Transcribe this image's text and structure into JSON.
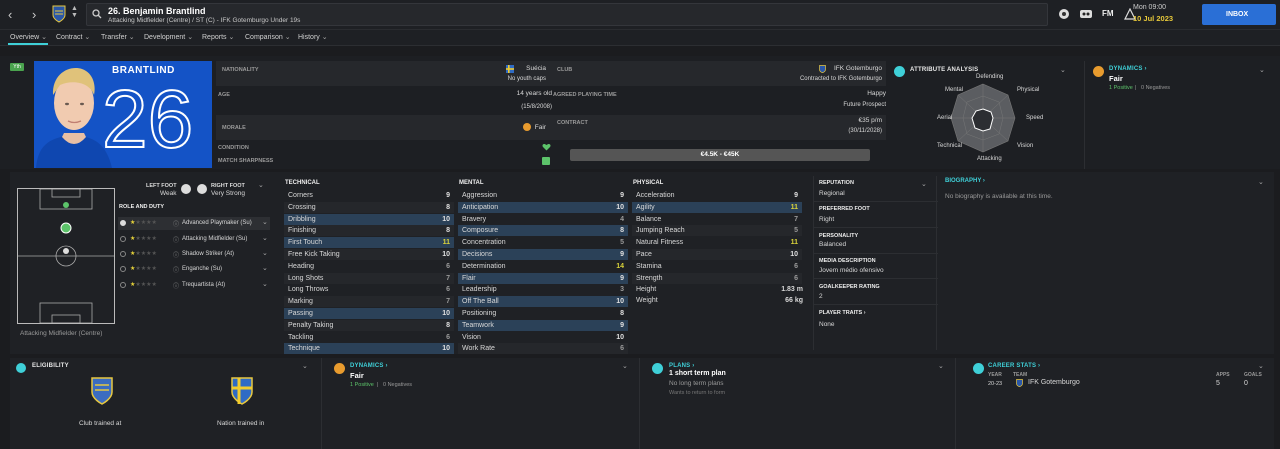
{
  "nav": {
    "back": "‹",
    "forward": "›"
  },
  "header": {
    "title": "26. Benjamin Brantlind",
    "subtitle": "Attacking Midfielder (Centre) / ST (C) - IFK Gotemburgo Under 19s",
    "date_day": "Mon 09:00",
    "date": "10 Jul 2023",
    "inbox": "INBOX",
    "fm": "FM"
  },
  "tabs": [
    {
      "label": "Overview"
    },
    {
      "label": "Contract"
    },
    {
      "label": "Transfer"
    },
    {
      "label": "Development"
    },
    {
      "label": "Reports"
    },
    {
      "label": "Comparison"
    },
    {
      "label": "History"
    }
  ],
  "profile": {
    "badge": "Yth",
    "shirt_name": "BRANTLIND",
    "shirt_number": "26"
  },
  "info": {
    "nationality_label": "NATIONALITY",
    "nationality": "Suécia",
    "youth_caps": "No youth caps",
    "age_label": "AGE",
    "age": "14 years old",
    "dob": "(15/8/2008)",
    "morale_label": "MORALE",
    "morale": "Fair",
    "condition_label": "CONDITION",
    "sharpness_label": "MATCH SHARPNESS",
    "club_label": "CLUB",
    "club": "IFK Gotemburgo",
    "contracted": "Contracted to IFK Gotemburgo",
    "playing_time_label": "AGREED PLAYING TIME",
    "playing_time": "Happy",
    "playing_time_role": "Future Prospect",
    "contract_label": "CONTRACT",
    "wage": "€35 p/m",
    "contract_end": "(30/11/2028)",
    "value": "€4.5K - €45K"
  },
  "attribute_analysis": {
    "title": "ATTRIBUTE ANALYSIS",
    "labels": [
      "Defending",
      "Physical",
      "Speed",
      "Vision",
      "Attacking",
      "Technical",
      "Aerial",
      "Mental"
    ]
  },
  "dynamics_top": {
    "title": "DYNAMICS",
    "value": "Fair",
    "positives": "1 Positive",
    "negatives": "0 Negatives"
  },
  "feet": {
    "left_label": "LEFT FOOT",
    "left": "Weak",
    "right_label": "RIGHT FOOT",
    "right": "Very Strong"
  },
  "role_duty": {
    "title": "ROLE AND DUTY",
    "roles": [
      "Advanced Playmaker (Su)",
      "Attacking Midfielder (Su)",
      "Shadow Striker (At)",
      "Enganche (Su)",
      "Trequartista (At)"
    ]
  },
  "position_caption": "Attacking Midfielder (Centre)",
  "technical": {
    "title": "TECHNICAL",
    "items": [
      [
        "Corners",
        "9"
      ],
      [
        "Crossing",
        "8"
      ],
      [
        "Dribbling",
        "10"
      ],
      [
        "Finishing",
        "8"
      ],
      [
        "First Touch",
        "11"
      ],
      [
        "Free Kick Taking",
        "10"
      ],
      [
        "Heading",
        "6"
      ],
      [
        "Long Shots",
        "7"
      ],
      [
        "Long Throws",
        "6"
      ],
      [
        "Marking",
        "7"
      ],
      [
        "Passing",
        "10"
      ],
      [
        "Penalty Taking",
        "8"
      ],
      [
        "Tackling",
        "6"
      ],
      [
        "Technique",
        "10"
      ]
    ]
  },
  "mental": {
    "title": "MENTAL",
    "items": [
      [
        "Aggression",
        "9"
      ],
      [
        "Anticipation",
        "10"
      ],
      [
        "Bravery",
        "4"
      ],
      [
        "Composure",
        "8"
      ],
      [
        "Concentration",
        "5"
      ],
      [
        "Decisions",
        "9"
      ],
      [
        "Determination",
        "14"
      ],
      [
        "Flair",
        "9"
      ],
      [
        "Leadership",
        "3"
      ],
      [
        "Off The Ball",
        "10"
      ],
      [
        "Positioning",
        "8"
      ],
      [
        "Teamwork",
        "9"
      ],
      [
        "Vision",
        "10"
      ],
      [
        "Work Rate",
        "6"
      ]
    ]
  },
  "physical": {
    "title": "PHYSICAL",
    "items": [
      [
        "Acceleration",
        "9"
      ],
      [
        "Agility",
        "11"
      ],
      [
        "Balance",
        "7"
      ],
      [
        "Jumping Reach",
        "5"
      ],
      [
        "Natural Fitness",
        "11"
      ],
      [
        "Pace",
        "10"
      ],
      [
        "Stamina",
        "6"
      ],
      [
        "Strength",
        "6"
      ]
    ],
    "height_label": "Height",
    "height": "1.83 m",
    "weight_label": "Weight",
    "weight": "66 kg"
  },
  "details": {
    "reputation_label": "REPUTATION",
    "reputation": "Regional",
    "foot_label": "PREFERRED FOOT",
    "foot": "Right",
    "personality_label": "PERSONALITY",
    "personality": "Balanced",
    "media_label": "MEDIA DESCRIPTION",
    "media": "Jovem médio ofensivo",
    "gk_label": "GOALKEEPER RATING",
    "gk": "2",
    "traits_label": "PLAYER TRAITS",
    "traits": "None"
  },
  "biography": {
    "title": "BIOGRAPHY",
    "text": "No biography is available at this time."
  },
  "eligibility": {
    "title": "ELIGIBILITY",
    "club_trained": "Club trained at",
    "nation_trained": "Nation trained in"
  },
  "dynamics_bottom": {
    "title": "DYNAMICS",
    "value": "Fair",
    "positives": "1 Positive",
    "negatives": "0 Negatives"
  },
  "plans": {
    "title": "PLANS",
    "short": "1 short term plan",
    "long": "No long term plans",
    "wants": "Wants to return to form"
  },
  "career": {
    "title": "CAREER STATS",
    "year_h": "YEAR",
    "team_h": "TEAM",
    "apps_h": "APPS",
    "goals_h": "GOALS",
    "year": "20-23",
    "team": "IFK Gotemburgo",
    "apps": "5",
    "goals": "0"
  },
  "colors": {
    "accent": "#3fd0d8",
    "highlight": "#2b4158",
    "green": "#5cc36a",
    "yellow": "#e6d23a",
    "inbox": "#2a6fd6"
  }
}
